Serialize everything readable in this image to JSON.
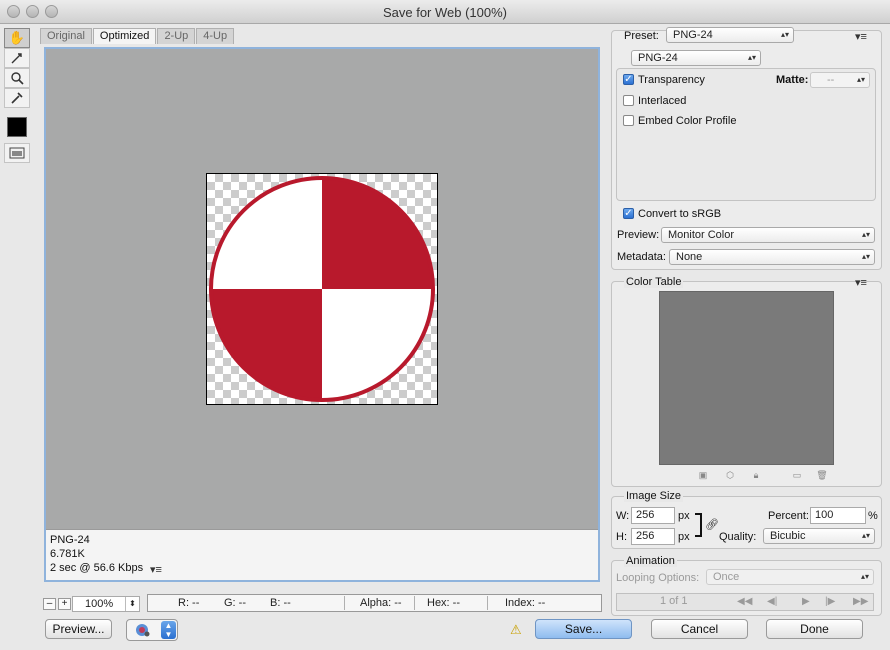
{
  "window": {
    "title": "Save for Web (100%)"
  },
  "tabs": [
    "Original",
    "Optimized",
    "2-Up",
    "4-Up"
  ],
  "info": {
    "format": "PNG-24",
    "size": "6.781K",
    "timing": "2 sec @ 56.6 Kbps",
    "menu_icon": "▾≡"
  },
  "zoom": {
    "minus": "–",
    "plus": "+",
    "value": "100%"
  },
  "readout": {
    "r": "R: --",
    "g": "G: --",
    "b": "B: --",
    "alpha": "Alpha: --",
    "hex": "Hex: --",
    "index": "Index: --"
  },
  "buttons": {
    "preview": "Preview...",
    "save": "Save...",
    "cancel": "Cancel",
    "done": "Done"
  },
  "preset": {
    "label": "Preset:",
    "value": "PNG-24",
    "format_value": "PNG-24",
    "menu_icon": "▾≡"
  },
  "options": {
    "transparency": "Transparency",
    "interlaced": "Interlaced",
    "embed_profile": "Embed Color Profile",
    "matte_label": "Matte:",
    "matte_value": "--",
    "convert_srgb": "Convert to sRGB",
    "preview_label": "Preview:",
    "preview_value": "Monitor Color",
    "metadata_label": "Metadata:",
    "metadata_value": "None"
  },
  "color_table": {
    "label": "Color Table",
    "menu_icon": "▾≡"
  },
  "image_size": {
    "label": "Image Size",
    "w_label": "W:",
    "w_value": "256",
    "h_label": "H:",
    "h_value": "256",
    "unit": "px",
    "percent_label": "Percent:",
    "percent_value": "100",
    "percent_unit": "%",
    "quality_label": "Quality:",
    "quality_value": "Bicubic"
  },
  "animation": {
    "label": "Animation",
    "looping_label": "Looping Options:",
    "looping_value": "Once",
    "frame": "1 of 1"
  },
  "colors": {
    "accent_red": "#b8192c",
    "canvas_gray": "#a8a9a9",
    "focus_blue": "#8fb3dc"
  }
}
